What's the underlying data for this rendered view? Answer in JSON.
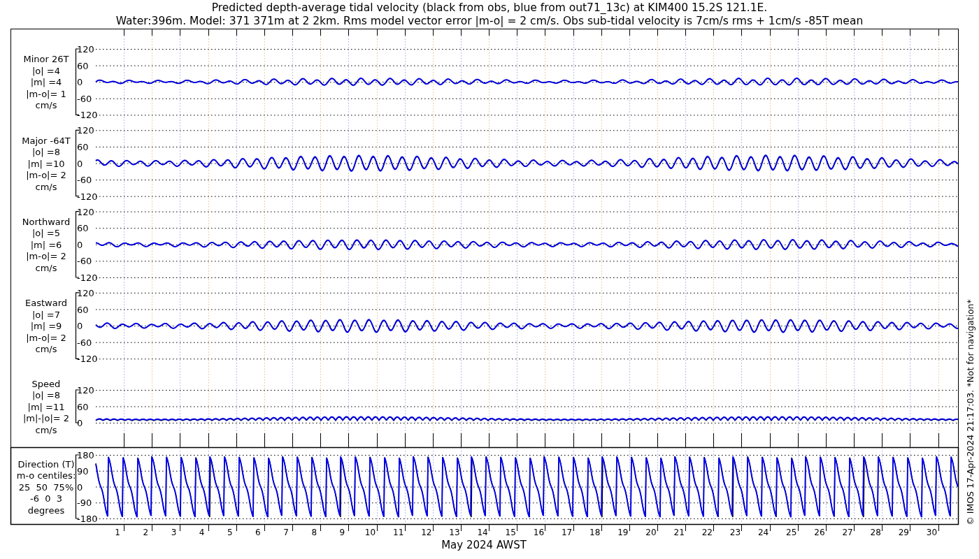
{
  "title_lines": [
    "Predicted depth-average tidal velocity (black from obs, blue from out71_13c) at KIM400 15.2S 121.1E.",
    "Water:396m. Model: 371 371m at 2 2km. Rms model vector error |m-o| = 2 cm/s. Obs sub-tidal velocity is 7cm/s rms + 1cm/s -85T mean"
  ],
  "panels": [
    {
      "kind": "signed",
      "label_lines": [
        "Minor 26T",
        "|o| =4",
        "|m| =4",
        "|m-o|= 1",
        "cm/s"
      ],
      "yticks": [
        "120",
        "60",
        "0",
        "-60",
        "-120"
      ]
    },
    {
      "kind": "signed",
      "label_lines": [
        "Major -64T",
        "|o| =8",
        "|m| =10",
        "|m-o|= 2",
        "cm/s"
      ],
      "yticks": [
        "120",
        "60",
        "0",
        "-60",
        "-120"
      ]
    },
    {
      "kind": "signed",
      "label_lines": [
        "Northward",
        "|o| =5",
        "|m| =6",
        "|m-o|= 2",
        "cm/s"
      ],
      "yticks": [
        "120",
        "60",
        "0",
        "-60",
        "-120"
      ]
    },
    {
      "kind": "signed",
      "label_lines": [
        "Eastward",
        "|o| =7",
        "|m| =9",
        "|m-o|= 2",
        "cm/s"
      ],
      "yticks": [
        "120",
        "60",
        "0",
        "-60",
        "-120"
      ]
    },
    {
      "kind": "speed",
      "label_lines": [
        "Speed",
        "|o| =8",
        "|m| =11",
        "|m|-|o|= 2",
        "cm/s"
      ],
      "yticks": [
        "120",
        "60",
        "0"
      ]
    },
    {
      "kind": "direction",
      "label_lines": [
        "Direction (T)",
        "m-o centiles:",
        "25  50  75%",
        "-6  0  3",
        "degrees"
      ],
      "yticks": [
        "180",
        "90",
        "0",
        "-90",
        "-180"
      ]
    }
  ],
  "xticks": [
    "1",
    "2",
    "3",
    "4",
    "5",
    "6",
    "7",
    "8",
    "9",
    "10",
    "11",
    "12",
    "13",
    "14",
    "15",
    "16",
    "17",
    "18",
    "19",
    "20",
    "21",
    "22",
    "23",
    "24",
    "25",
    "26",
    "27",
    "28",
    "29",
    "30"
  ],
  "xlabel": "May 2024 AWST",
  "credit": "© IMOS 17-Apr-2024 21:17:03. *Not for navigation*"
}
